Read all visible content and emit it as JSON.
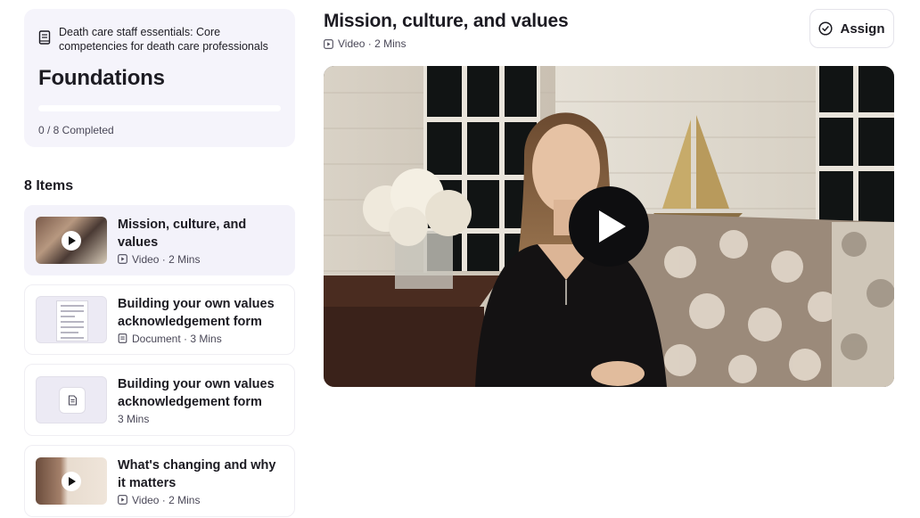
{
  "course": {
    "subtitle": "Death care staff essentials: Core competencies for death care professionals",
    "title": "Foundations",
    "progress_fraction": 0,
    "progress_label": "0 / 8 Completed",
    "icon": "book-icon"
  },
  "items_heading": "8 Items",
  "items": [
    {
      "title": "Mission, culture, and values",
      "meta": "Video · 2 Mins",
      "type": "video",
      "icon": "video-icon",
      "active": true
    },
    {
      "title": "Building your own values acknowledgement form",
      "meta": "Document · 3 Mins",
      "type": "document",
      "icon": "document-icon",
      "active": false
    },
    {
      "title": "Building your own values acknowledgement form",
      "meta": "3 Mins",
      "type": "file",
      "icon": "file-icon",
      "active": false
    },
    {
      "title": "What's changing and why it matters",
      "meta": "Video · 2 Mins",
      "type": "video",
      "icon": "video-icon",
      "active": false
    }
  ],
  "header": {
    "title": "Mission, culture, and values",
    "meta": "Video · 2 Mins",
    "assign_label": "Assign",
    "assign_icon": "check-circle-icon"
  },
  "player": {
    "play_icon": "play-icon"
  },
  "colors": {
    "accent": "#5b4fd6",
    "card_bg": "#f5f4fb",
    "text": "#1c1b22",
    "muted": "#4a4858"
  }
}
